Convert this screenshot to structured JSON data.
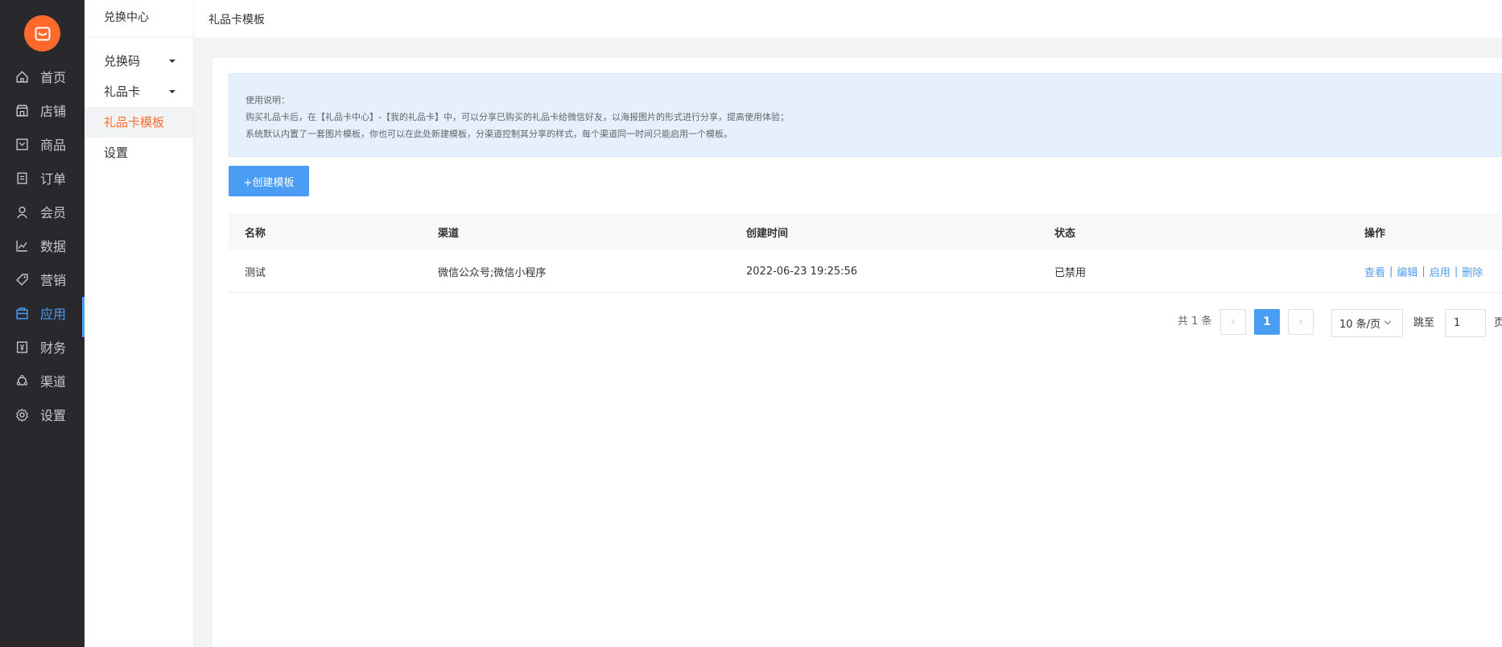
{
  "nav": {
    "items": [
      {
        "label": "首页",
        "icon": "home-icon"
      },
      {
        "label": "店铺",
        "icon": "store-icon"
      },
      {
        "label": "商品",
        "icon": "goods-icon"
      },
      {
        "label": "订单",
        "icon": "order-icon"
      },
      {
        "label": "会员",
        "icon": "user-icon"
      },
      {
        "label": "数据",
        "icon": "chart-icon"
      },
      {
        "label": "营销",
        "icon": "tag-icon"
      },
      {
        "label": "应用",
        "icon": "app-icon",
        "active": true
      },
      {
        "label": "财务",
        "icon": "finance-icon"
      },
      {
        "label": "渠道",
        "icon": "channel-icon"
      },
      {
        "label": "设置",
        "icon": "gear-icon"
      }
    ]
  },
  "submenu": {
    "title": "兑换中心",
    "items": [
      {
        "label": "兑换码",
        "expandable": true
      },
      {
        "label": "礼品卡",
        "expandable": true
      },
      {
        "label": "礼品卡模板",
        "active": true
      },
      {
        "label": "设置"
      }
    ]
  },
  "topbar": {
    "crumb": "礼品卡模板"
  },
  "notice": {
    "title": "使用说明：",
    "line1": "购买礼品卡后，在【礼品卡中心】-【我的礼品卡】中，可以分享已购买的礼品卡给微信好友，以海报图片的形式进行分享，提高使用体验；",
    "line2": "系统默认内置了一套图片模板，你也可以在此处新建模板，分渠道控制其分享的样式，每个渠道同一时间只能启用一个模板。"
  },
  "toolbar": {
    "create_label": "+创建模板"
  },
  "table": {
    "headers": [
      "名称",
      "渠道",
      "创建时间",
      "状态",
      "操作"
    ],
    "rows": [
      {
        "name": "测试",
        "channel": "微信公众号;微信小程序",
        "created": "2022-06-23 19:25:56",
        "status": "已禁用",
        "actions": [
          "查看",
          "编辑",
          "启用",
          "删除"
        ]
      }
    ]
  },
  "pagination": {
    "total_text": "共 1 条",
    "current_page": "1",
    "page_size": "10 条/页",
    "jump_label": "跳至",
    "jump_value": "1",
    "jump_tail": "页"
  },
  "colors": {
    "brand": "#ff6a2c",
    "primary": "#4b9cf3",
    "nav_bg": "#28282d"
  }
}
